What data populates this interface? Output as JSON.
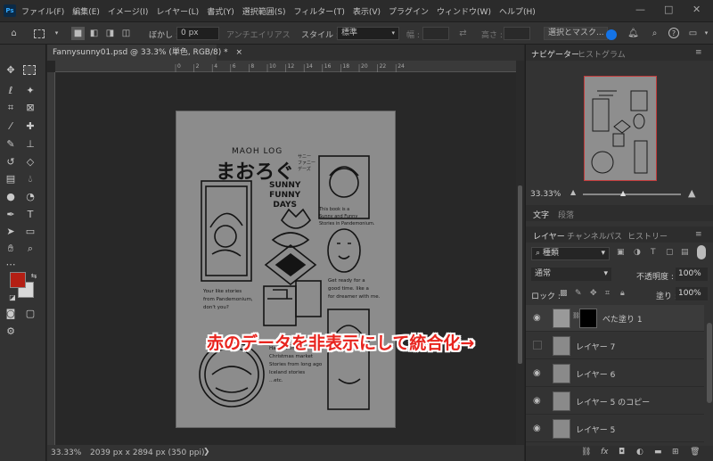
{
  "app": {
    "logo": "Ps",
    "menu": [
      "ファイル(F)",
      "編集(E)",
      "イメージ(I)",
      "レイヤー(L)",
      "書式(Y)",
      "選択範囲(S)",
      "フィルター(T)",
      "表示(V)",
      "プラグイン",
      "ウィンドウ(W)",
      "ヘルプ(H)"
    ],
    "window_buttons": [
      "—",
      "□",
      "✕"
    ]
  },
  "options": {
    "feather_label": "ぼかし :",
    "feather_value": "0 px",
    "antialias_label": "アンチエイリアス",
    "style_label": "スタイル :",
    "style_value": "標準",
    "width_label": "幅 :",
    "height_label": "高さ :",
    "select_mask_button": "選択とマスク..."
  },
  "document": {
    "tab_title": "Fannysunny01.psd @ 33.3% (単色, RGB/8) *",
    "close_glyph": "×",
    "status_zoom": "33.33%",
    "status_info": "2039 px x 2894 px (350 ppi)",
    "ruler_marks": [
      "0",
      "2",
      "4",
      "6",
      "8",
      "10",
      "12",
      "14",
      "16",
      "18",
      "20",
      "22",
      "24"
    ]
  },
  "artwork": {
    "title_small": "MAOH LOG",
    "title_main": "まおろぐ",
    "title_side": [
      "サニー",
      "ファニー",
      "デーズ"
    ],
    "sunny": [
      "SUNNY",
      "FUNNY",
      "DAYS"
    ],
    "blurb": [
      "This book is a",
      "Sunny and Funny",
      "Stories in Pandemonium."
    ],
    "left_text": [
      "Your like stories",
      "from Pandemonium,",
      "don't you?"
    ],
    "right_text": [
      "Get ready for a",
      "good time. like a",
      "for dreamer with me."
    ],
    "bottom_text": [
      "Halloween",
      "Christmas market",
      "Stories from long ago",
      "Iceland stories",
      "...etc."
    ]
  },
  "navigator": {
    "tabs": [
      "ナビゲーター",
      "ヒストグラム"
    ],
    "zoom": "33.33%"
  },
  "char_panel": {
    "tabs": [
      "文字",
      "段落"
    ]
  },
  "layers_panel": {
    "tabs": [
      "レイヤー",
      "チャンネル",
      "パス",
      "ヒストリー"
    ],
    "filter_kind": "種類",
    "blend_mode": "通常",
    "opacity_label": "不透明度 :",
    "opacity_value": "100%",
    "lock_label": "ロック :",
    "fill_label": "塗り :",
    "fill_value": "100%",
    "layers": [
      {
        "name": "べた塗り 1",
        "visible": true
      },
      {
        "name": "レイヤー 7",
        "visible": false
      },
      {
        "name": "レイヤー 6",
        "visible": true
      },
      {
        "name": "レイヤー 5 のコピー",
        "visible": true
      },
      {
        "name": "レイヤー 5",
        "visible": true
      }
    ],
    "footer_icons": [
      "link-icon",
      "fx-icon",
      "mask-icon",
      "adjustment-icon",
      "folder-icon",
      "new-layer-icon",
      "trash-icon"
    ]
  },
  "annotation": "赤のデータを非表示にして統合化→",
  "colors": {
    "foreground": "#b41f14",
    "background": "#d8d8d8",
    "annotation_red": "#e8241e"
  }
}
